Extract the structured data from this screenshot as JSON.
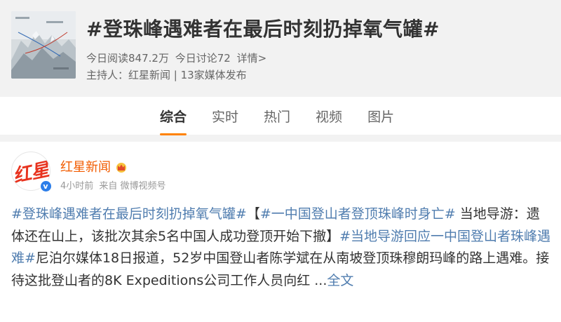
{
  "topic": {
    "title": "#登珠峰遇难者在最后时刻扔掉氧气罐#",
    "reads": "今日阅读847.2万",
    "discussions": "今日讨论72",
    "details_link": "详情>",
    "host": "主持人：红星新闻 | 13家媒体发布"
  },
  "tabs": [
    {
      "label": "综合",
      "active": true
    },
    {
      "label": "实时",
      "active": false
    },
    {
      "label": "热门",
      "active": false
    },
    {
      "label": "视频",
      "active": false
    },
    {
      "label": "图片",
      "active": false
    }
  ],
  "post": {
    "author": "红星新闻",
    "avatar_text": "红星",
    "time": "4小时前",
    "source": "来自 微博视频号",
    "segments": {
      "tag1": "#登珠峰遇难者在最后时刻扔掉氧气罐#",
      "t1": "【",
      "tag2": "#一中国登山者登顶珠峰时身亡#",
      "t2": " 当地导游：遗体还在山上，该批次其余5名中国人成功登顶开始下撤】",
      "tag3": "#当地导游回应一中国登山者珠峰遇难#",
      "t3": "尼泊尔媒体18日报道，52岁中国登山者陈学斌在从南坡登顶珠穆朗玛峰的路上遇难。接待这批登山者的8K Expeditions公司工作人员向红 ...",
      "more": "全文"
    }
  },
  "colors": {
    "accent": "#ff8200",
    "hashtag": "#507daf",
    "author": "#f25c00",
    "verified": "#2b7de9"
  },
  "icons": {
    "crown": "crown-icon",
    "verified": "verified-badge-icon"
  }
}
